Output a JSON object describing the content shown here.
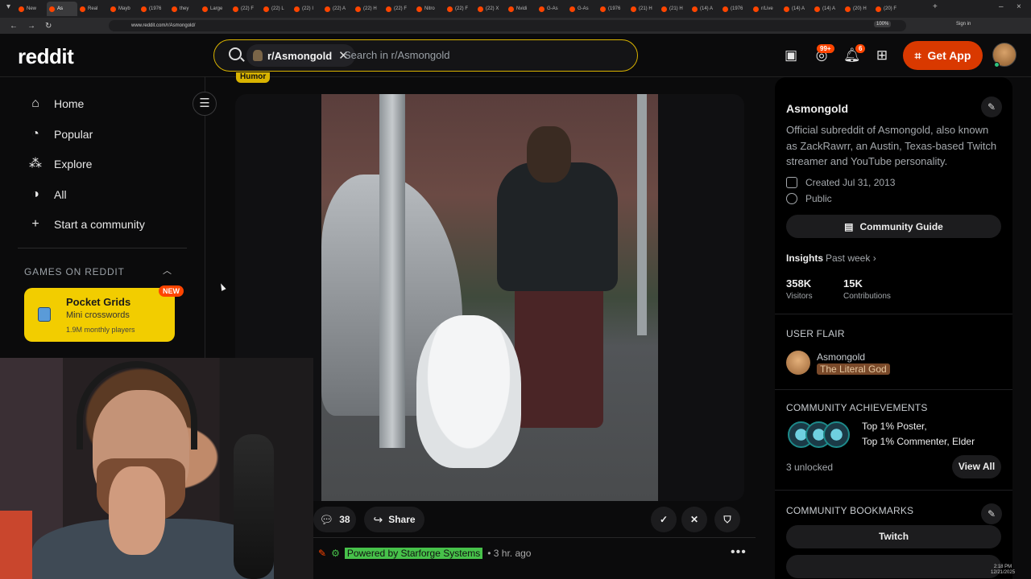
{
  "browser": {
    "tabs": [
      "New",
      "As",
      "Real",
      "Mayb",
      "(1976",
      "they",
      "Large",
      "(22) F",
      "(22) L",
      "(22) I",
      "(22) A",
      "(22) H",
      "(22) F",
      "Nitro",
      "(22) F",
      "(22) X",
      "Nvidi",
      "G-As",
      "G-As",
      "(1976",
      "(21) H",
      "(21) H",
      "(14) A",
      "(1976",
      "r/Live",
      "(14) A",
      "(14) A",
      "(20) H",
      "(20) F"
    ],
    "url": "www.reddit.com/r/Asmongold/",
    "zoom": "100%",
    "signin": "Sign in",
    "time": "2:18 PM",
    "date": "12/21/2025"
  },
  "header": {
    "logo": "reddit",
    "search_chip": "r/Asmongold",
    "search_placeholder": "Search in r/Asmongold",
    "chat_badge": "99+",
    "notif_badge": "6",
    "get_app": "Get App"
  },
  "sidebar": {
    "items": [
      {
        "label": "Home",
        "icon": "home-icon"
      },
      {
        "label": "Popular",
        "icon": "popular-icon"
      },
      {
        "label": "Explore",
        "icon": "explore-icon"
      },
      {
        "label": "All",
        "icon": "all-icon"
      },
      {
        "label": "Start a community",
        "icon": "plus-icon"
      }
    ],
    "games_heading": "GAMES ON REDDIT",
    "game": {
      "title": "Pocket Grids",
      "subtitle": "Mini crosswords",
      "players": "1.9M monthly players",
      "badge": "NEW"
    }
  },
  "post": {
    "flair": "Humor",
    "comments": "38",
    "share": "Share"
  },
  "next_post": {
    "sponsor": "Powered by Starforge Systems",
    "time": "• 3 hr. ago"
  },
  "community": {
    "name": "Asmongold",
    "description": "Official subreddit of Asmongold, also known as ZackRawrr, an Austin, Texas-based Twitch streamer and YouTube personality.",
    "created": "Created Jul 31, 2013",
    "visibility": "Public",
    "guide": "Community Guide",
    "insights": "Insights",
    "period": "Past week",
    "visitors_val": "358K",
    "visitors_lbl": "Visitors",
    "contrib_val": "15K",
    "contrib_lbl": "Contributions",
    "user_flair_heading": "USER FLAIR",
    "flair_user": "Asmongold",
    "flair_text": "The Literal God",
    "achievements_heading": "COMMUNITY ACHIEVEMENTS",
    "achievements_line1": "Top 1% Poster,",
    "achievements_line2": "Top 1% Commenter, Elder",
    "unlocked": "3 unlocked",
    "view_all": "View All",
    "bookmarks_heading": "COMMUNITY BOOKMARKS",
    "bookmark_1": "Twitch"
  },
  "colors": {
    "accent": "#ff4500",
    "search_border": "#d9b300",
    "get_app_bg": "#d93900",
    "game_card": "#f2cd00"
  }
}
